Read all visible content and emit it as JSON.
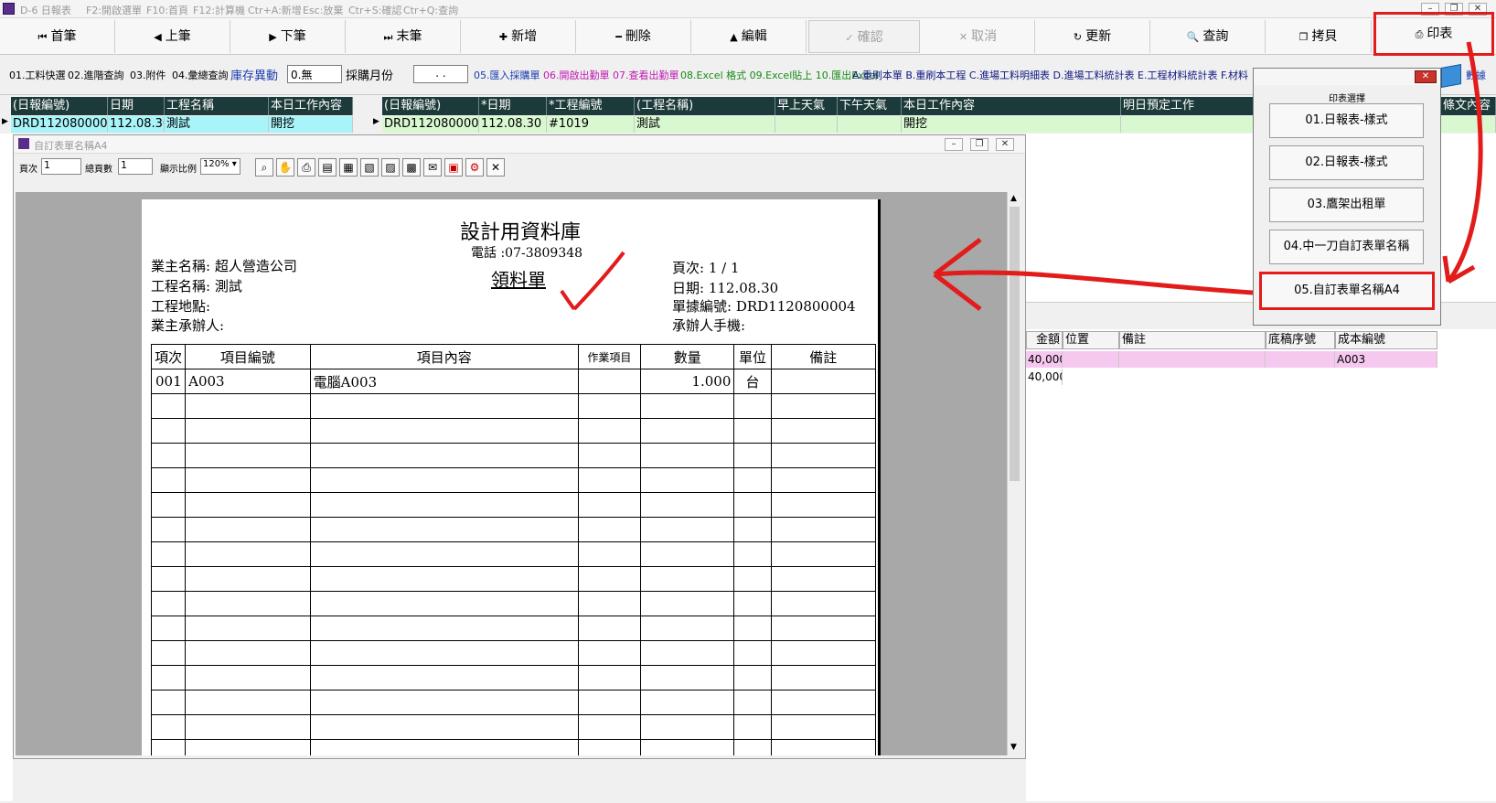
{
  "app": {
    "title": "D-6 日報表",
    "hints": [
      "F2:開啟選單",
      "F10:首頁",
      "F12:計算機",
      "Ctr+A:新增",
      "Esc:放棄",
      "Ctr+S:確認",
      "Ctr+Q:查詢"
    ]
  },
  "toolbar": {
    "first": "首筆",
    "prev": "上筆",
    "next": "下筆",
    "last": "末筆",
    "add": "新增",
    "delete": "刪除",
    "edit": "編輯",
    "confirm": "確認",
    "cancel": "取消",
    "refresh": "更新",
    "query": "查詢",
    "copy": "拷貝",
    "print": "印表"
  },
  "row2": {
    "links": [
      "01.工料快選",
      "02.進階查詢",
      "03.附件",
      "04.彙總查詢"
    ],
    "stock_label": "庫存異動",
    "stock_value": "0.無",
    "month_label": "採購月份",
    "month_value": ". .",
    "actions_blue": "05.匯入採購單",
    "actions_magenta": "06.開啟出勤單  07.查看出勤單",
    "actions_green": "08.Excel 格式  09.Excel貼上  10.匯出Excel",
    "actions_navy": "A.重刷本單  B.重刷本工程  C.進場工料明細表  D.進場工料統計表  E.工程材料統計表  F.材料",
    "data_label": "數據"
  },
  "left_grid": {
    "headers": [
      "(日報編號)",
      "日期",
      "工程名稱",
      "本日工作內容"
    ],
    "row": [
      "DRD1120800004",
      "112.08.30",
      "測試",
      "開挖"
    ]
  },
  "main_grid": {
    "headers": [
      "(日報編號)",
      "*日期",
      "*工程編號",
      "(工程名稱)",
      "早上天氣",
      "下午天氣",
      "本日工作內容",
      "明日預定工作",
      "條文內容"
    ],
    "row": [
      "DRD1120800004",
      "112.08.30",
      "#1019",
      "測試",
      "",
      "",
      "開挖",
      "",
      ""
    ]
  },
  "lower_grid": {
    "headers": [
      "金額",
      "位置",
      "備註",
      "底稿序號",
      "成本編號"
    ],
    "rows": [
      [
        "40,000",
        "",
        "",
        "",
        "A003"
      ],
      [
        "40,000",
        "",
        "",
        "",
        ""
      ]
    ]
  },
  "inner_window": {
    "title": "自訂表單名稱A4",
    "page_label": "頁次",
    "page_value": "1",
    "total_label": "總頁數",
    "total_value": "1",
    "zoom_label": "顯示比例",
    "zoom_value": "120%"
  },
  "report": {
    "company": "設計用資料庫",
    "phone": "電話 :07-3809348",
    "doc_title": "領料單",
    "owner": "業主名稱: 超人營造公司",
    "project": "工程名稱: 測試",
    "site": "工程地點:",
    "contractor": "業主承辦人:",
    "page": "頁次:     1   /   1",
    "date": "日期: 112.08.30",
    "doc_no": "單據編號: DRD1120800004",
    "phone2": "承辦人手機:",
    "columns": [
      "項次",
      "項目編號",
      "項目內容",
      "作業項目",
      "數量",
      "單位",
      "備註"
    ],
    "items": [
      [
        "001",
        "A003",
        "電腦A003",
        "",
        "1.000",
        "台",
        ""
      ]
    ]
  },
  "print_menu": {
    "title": "印表選擇",
    "items": [
      "01.日報表-樣式",
      "02.日報表-樣式",
      "03.鷹架出租單",
      "04.中一刀自訂表單名稱",
      "05.自訂表單名稱A4"
    ]
  },
  "colors": {
    "grid_header": "#1d3a3a",
    "row_cyan": "#a8f4f8",
    "row_green": "#d8f8d0",
    "row_pink": "#f6c8f0",
    "annotation_red": "#e21b1b"
  }
}
